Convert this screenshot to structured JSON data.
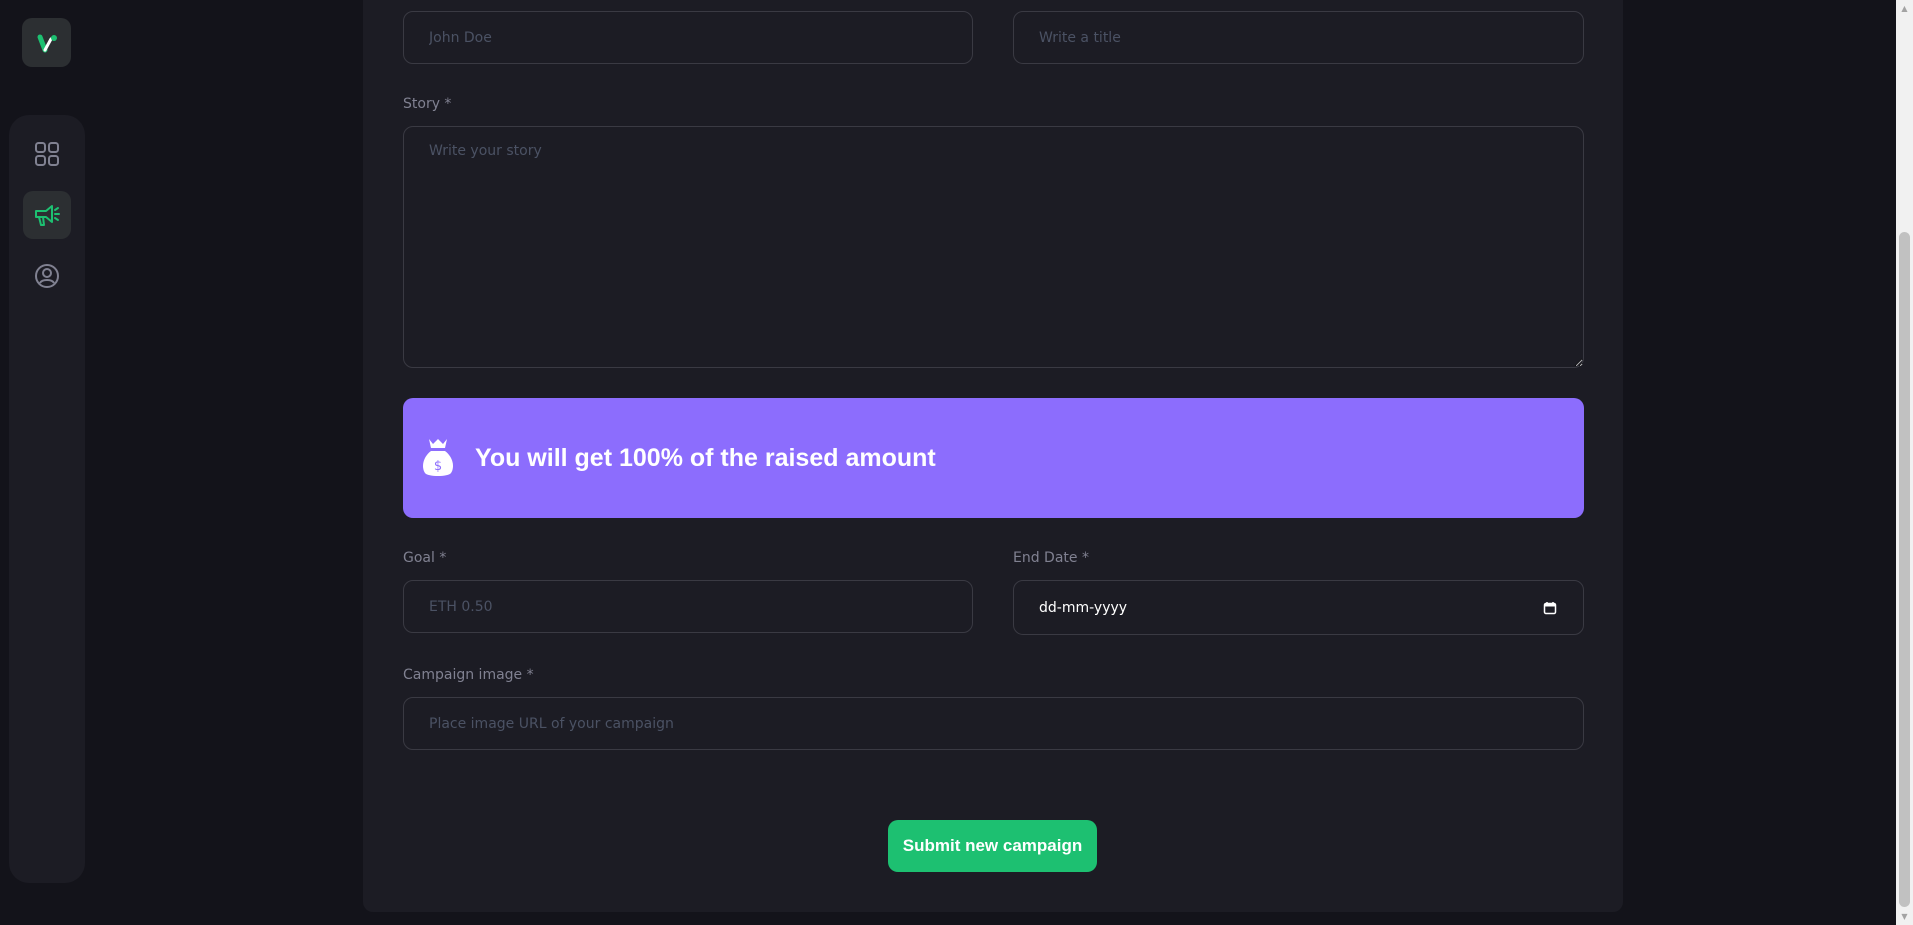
{
  "sidebar": {
    "logo_icon": "logo-icon",
    "items": [
      {
        "icon": "dashboard-icon",
        "active": false
      },
      {
        "icon": "campaign-icon",
        "active": true
      },
      {
        "icon": "profile-icon",
        "active": false
      }
    ]
  },
  "form": {
    "name": {
      "placeholder": "John Doe"
    },
    "title": {
      "placeholder": "Write a title"
    },
    "story": {
      "label": "Story *",
      "placeholder": "Write your story"
    },
    "banner": {
      "text": "You will get 100% of the raised amount",
      "icon": "money-bag-icon"
    },
    "goal": {
      "label": "Goal *",
      "placeholder": "ETH 0.50"
    },
    "end_date": {
      "label": "End Date *",
      "value": "dd-mm-yyyy",
      "icon": "calendar-icon"
    },
    "image": {
      "label": "Campaign image *",
      "placeholder": "Place image URL of your campaign"
    },
    "submit_label": "Submit new campaign"
  },
  "colors": {
    "background": "#13131a",
    "card": "#1c1c24",
    "accent_green": "#1dc071",
    "banner_purple": "#8c6dfd"
  }
}
